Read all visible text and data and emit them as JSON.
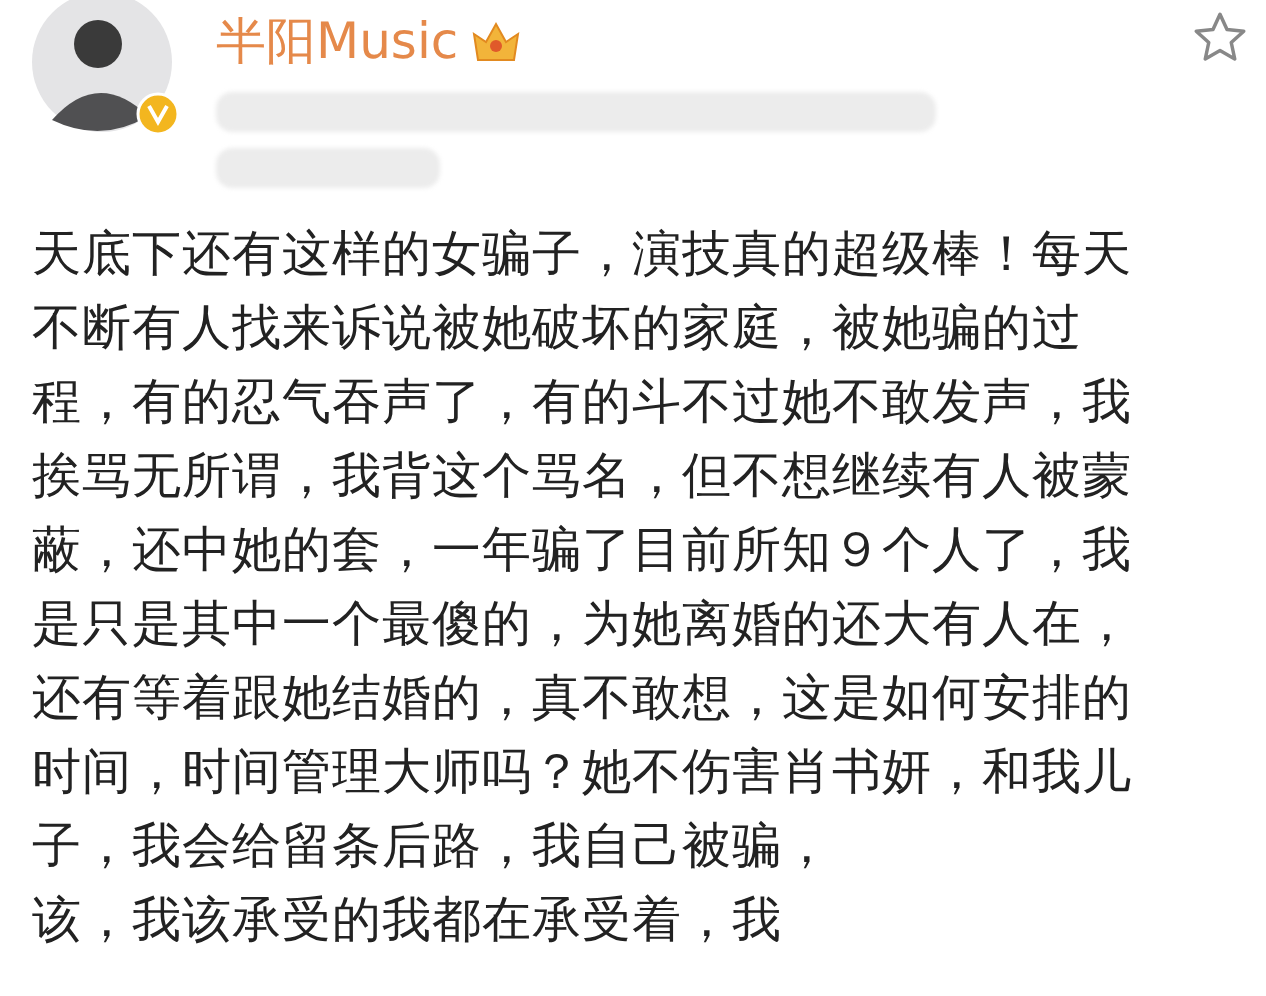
{
  "author": {
    "name": "半阳Music",
    "verified": true,
    "crowned": true
  },
  "favorite": {
    "selected": false
  },
  "post": {
    "lines": [
      "天底下还有这样的女骗子，演技真的超级棒！每天",
      "不断有人找来诉说被她破坏的家庭，被她骗的过",
      "程，有的忍气吞声了，有的斗不过她不敢发声，我",
      "挨骂无所谓，我背这个骂名，但不想继续有人被蒙",
      "蔽，还中她的套，一年骗了目前所知９个人了，我",
      "是只是其中一个最傻的，为她离婚的还大有人在，",
      "还有等着跟她结婚的，真不敢想，这是如何安排的",
      "时间，时间管理大师吗？她不伤害肖书妍，和我儿",
      "子，我会给留条后路，我自己被骗，",
      "该，我该承受的我都在承受着，我"
    ]
  }
}
